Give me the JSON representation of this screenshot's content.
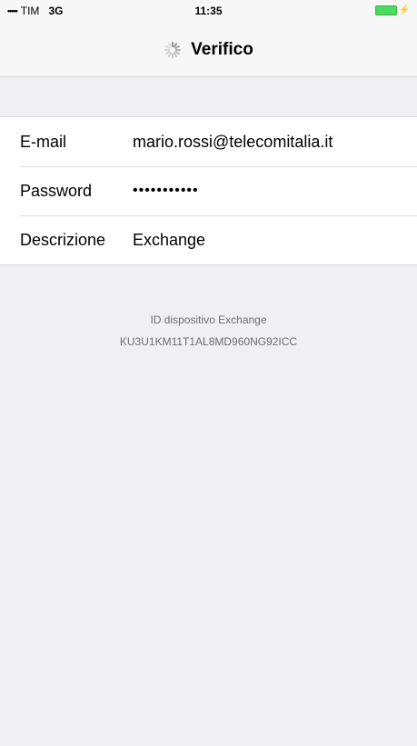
{
  "status_bar": {
    "signal": "•••••",
    "carrier": "TIM",
    "network": "3G",
    "time": "11:35"
  },
  "nav": {
    "title": "Verifico"
  },
  "form": {
    "rows": [
      {
        "label": "E-mail",
        "value": "mario.rossi@telecomitalia.it"
      },
      {
        "label": "Password",
        "value": "•••••••••••"
      },
      {
        "label": "Descrizione",
        "value": "Exchange"
      }
    ]
  },
  "device": {
    "label": "ID dispositivo Exchange",
    "id": "KU3U1KM11T1AL8MD960NG92ICC"
  },
  "colors": {
    "background": "#efeff4",
    "battery": "#4cd964"
  },
  "icons": [
    "signal-icon",
    "battery-icon",
    "spinner-icon"
  ]
}
